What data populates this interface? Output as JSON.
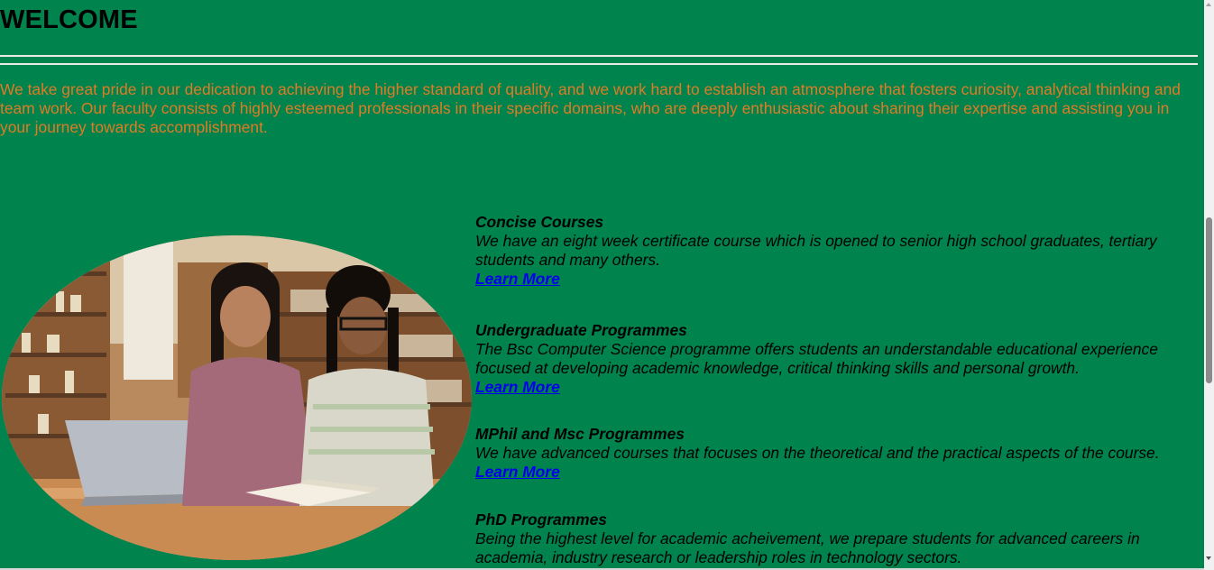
{
  "welcome": {
    "title": "WELCOME",
    "intro": "We take great pride in our dedication to achieving the higher standard of quality, and we work hard to establish an atmosphere that fosters curiosity, analytical thinking and team work. Our faculty consists of highly esteemed professionals in their specific domains, who are deeply enthusiastic about sharing their expertise and assisting you in your journey towards accomplishment."
  },
  "programmes": [
    {
      "title": "Concise Courses",
      "description": "We have an eight week certificate course which is opened to senior high school graduates, tertiary students and many others.",
      "link": "Learn More"
    },
    {
      "title": "Undergraduate Programmes",
      "description": "The Bsc Computer Science programme offers students an understandable educational experience focused at developing academic knowledge, critical thinking skills and personal growth.",
      "link": "Learn More"
    },
    {
      "title": "MPhil and Msc Programmes",
      "description": "We have advanced courses that focuses on the theoretical and the practical aspects of the course.",
      "link": "Learn More"
    },
    {
      "title": "PhD Programmes",
      "description": "Being the highest level for academic acheivement, we prepare students for advanced careers in academia, industry research or leadership roles in technology sectors."
    }
  ],
  "image": {
    "icon": "students-studying-photo"
  },
  "colors": {
    "background": "#00834d",
    "intro_text": "#e07b25",
    "link": "#0000ee",
    "rule": "#e6ece8"
  }
}
